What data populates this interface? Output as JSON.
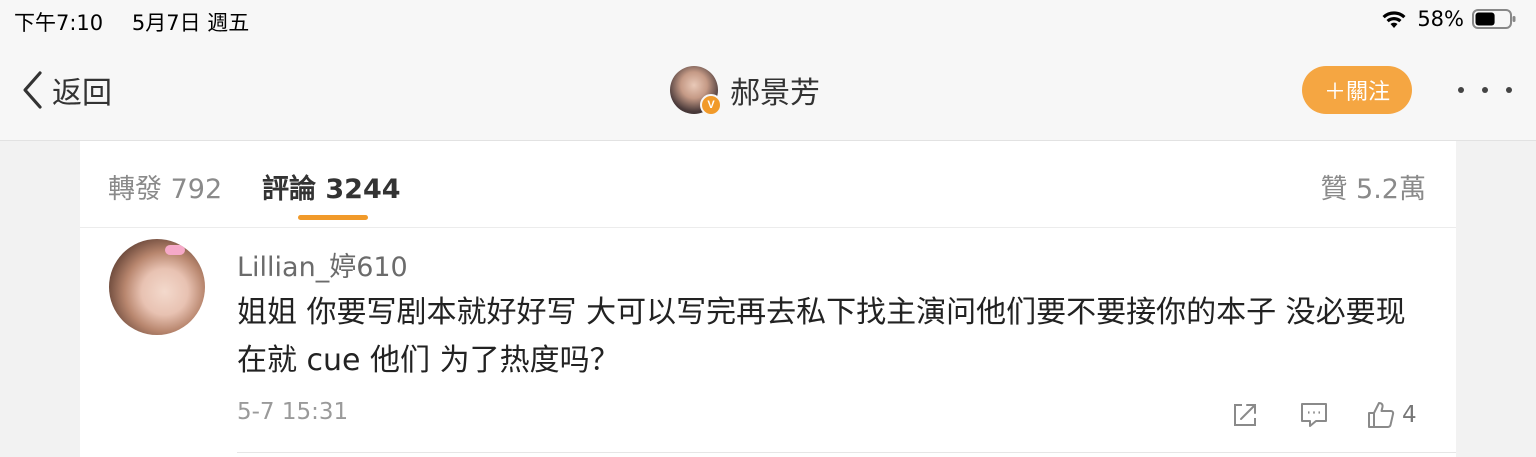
{
  "status_bar": {
    "time": "下午7:10",
    "date": "5月7日 週五",
    "battery": "58%",
    "battery_level": 0.58
  },
  "nav": {
    "back_label": "返回",
    "title": "郝景芳",
    "verified_mark": "V",
    "follow_label": "＋關注"
  },
  "tabs": {
    "reposts": "轉發 792",
    "comments": "評論 3244",
    "likes": "贊 5.2萬"
  },
  "comment": {
    "username": "Lillian_婷610",
    "text": "姐姐 你要写剧本就好好写 大可以写完再去私下找主演问他们要不要接你的本子 没必要现在就 cue 他们 为了热度吗？",
    "timestamp": "5-7 15:31",
    "like_count": "4"
  },
  "colors": {
    "accent": "#f19a2a",
    "follow_button": "#f5a642",
    "background": "#f2f2f2"
  },
  "icons": [
    "back-chevron-icon",
    "wifi-icon",
    "battery-icon",
    "verified-badge-icon",
    "more-icon",
    "share-icon",
    "comment-icon",
    "like-thumb-icon"
  ]
}
